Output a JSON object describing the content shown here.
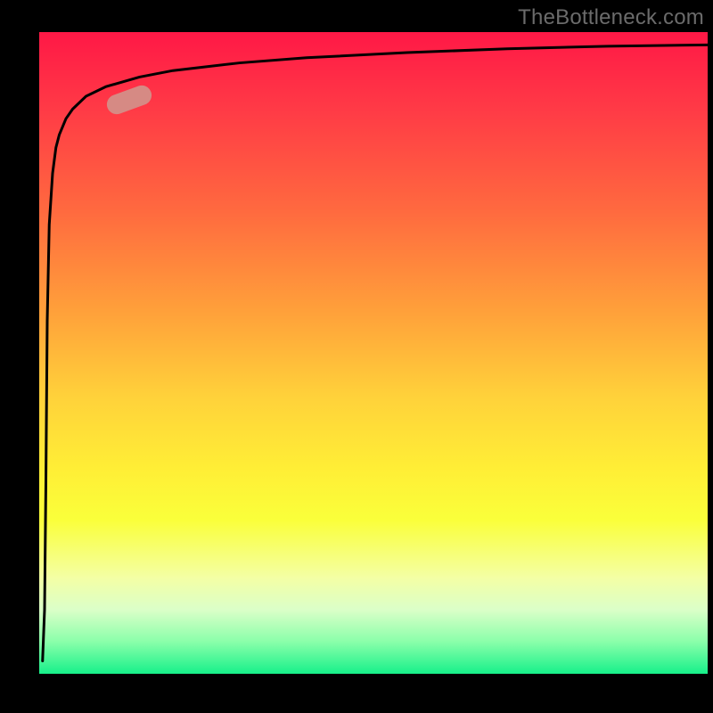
{
  "attribution": "TheBottleneck.com",
  "colors": {
    "frame": "#000000",
    "gradient_top": "#ff1846",
    "gradient_bottom": "#17f08a",
    "curve": "#000000",
    "marker": "#d68a84",
    "attribution_text": "#6b6b6b"
  },
  "chart_data": {
    "type": "line",
    "title": "",
    "xlabel": "",
    "ylabel": "",
    "xlim": [
      0,
      100
    ],
    "ylim": [
      0,
      100
    ],
    "grid": false,
    "series": [
      {
        "name": "curve",
        "x": [
          0.5,
          0.8,
          1.0,
          1.2,
          1.5,
          2.0,
          2.5,
          3.0,
          4.0,
          5.0,
          7.0,
          10,
          15,
          20,
          30,
          40,
          55,
          70,
          85,
          100
        ],
        "y": [
          2,
          10,
          30,
          55,
          70,
          78,
          82,
          84,
          86.5,
          88,
          90,
          91.5,
          93,
          94,
          95.2,
          96,
          96.8,
          97.4,
          97.8,
          98
        ]
      }
    ],
    "marker": {
      "x": 13.5,
      "y": 89.5,
      "angle_deg": 20
    },
    "legend": false
  }
}
